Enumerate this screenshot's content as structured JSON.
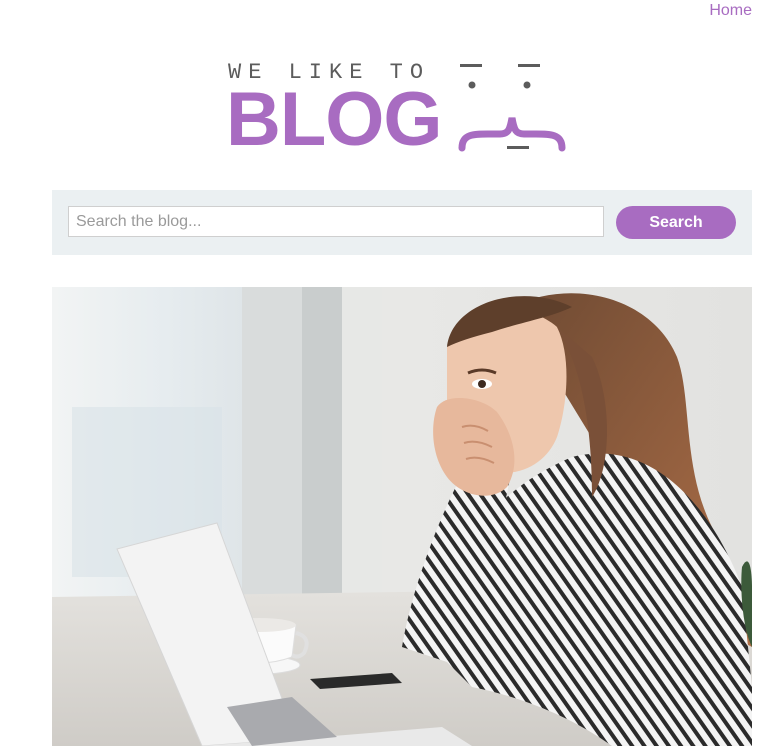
{
  "nav": {
    "home_label": "Home"
  },
  "logo": {
    "tagline": "WE LIKE TO",
    "wordmark": "BLOG"
  },
  "search": {
    "placeholder": "Search the blog...",
    "value": "",
    "button_label": "Search"
  },
  "colors": {
    "accent": "#a86cc1",
    "search_bar_bg": "#ebf0f2",
    "logo_gray": "#5c5c5c"
  },
  "hero": {
    "icon": "hero-photo-woman-laptop"
  }
}
